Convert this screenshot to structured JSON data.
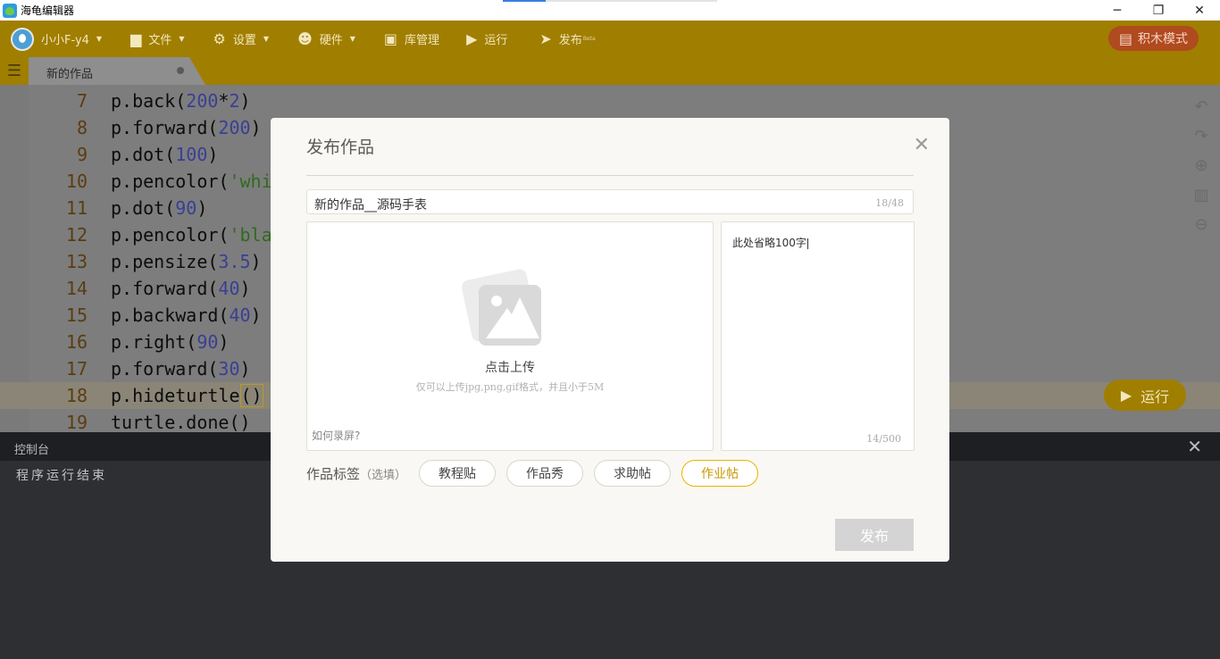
{
  "window": {
    "title": "海龟编辑器",
    "loading_progress": 0.2,
    "minimize": "─",
    "restore": "❐",
    "close": "✕"
  },
  "toolbar": {
    "user": "小小F-y4",
    "file": "文件",
    "settings": "设置",
    "hardware": "硬件",
    "library": "库管理",
    "run": "运行",
    "publish": "发布",
    "publish_badge": "Beta",
    "block_mode": "积木模式"
  },
  "tab": {
    "name": "新的作品"
  },
  "editor": {
    "lines": [
      {
        "no": "7",
        "code": "p.back(200*2)"
      },
      {
        "no": "8",
        "code": "p.forward(200)"
      },
      {
        "no": "9",
        "code": "p.dot(100)"
      },
      {
        "no": "10",
        "code": "p.pencolor('whi"
      },
      {
        "no": "11",
        "code": "p.dot(90)"
      },
      {
        "no": "12",
        "code": "p.pencolor('bla"
      },
      {
        "no": "13",
        "code": "p.pensize(3.5)"
      },
      {
        "no": "14",
        "code": "p.forward(40)"
      },
      {
        "no": "15",
        "code": "p.backward(40)"
      },
      {
        "no": "16",
        "code": "p.right(90)"
      },
      {
        "no": "17",
        "code": "p.forward(30)"
      },
      {
        "no": "18",
        "code": "p.hideturtle",
        "code_paren": "()"
      },
      {
        "no": "19",
        "code": "turtle.done()"
      }
    ],
    "run_button": "运行"
  },
  "console": {
    "title": "控制台",
    "output": "程序运行结束"
  },
  "modal": {
    "title": "发布作品",
    "name_value": "新的作品__源码手表",
    "name_count": "18/48",
    "upload_label": "点击上传",
    "upload_hint": "仅可以上传jpg,png,gif格式，并且小于5M",
    "record_link": "如何录屏?",
    "description": "此处省略100字",
    "desc_count": "14/500",
    "tags_label": "作品标签",
    "tags_optional": "（选填）",
    "tags": [
      "教程贴",
      "作品秀",
      "求助帖",
      "作业帖"
    ],
    "publish_button": "发布"
  },
  "colors": {
    "toolbar": "#a07e00",
    "accent": "#e8b400",
    "block_mode": "#b04a1f"
  }
}
